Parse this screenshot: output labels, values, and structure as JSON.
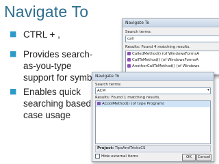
{
  "slide": {
    "title": "Navigate To",
    "bullets": [
      "CTRL + ,",
      "Provides search-as-you-type support for symbols",
      "Enables quick searching based on case usage"
    ]
  },
  "dialog_back": {
    "title": "Navigate To",
    "search_label": "Search terms:",
    "search_value": "call",
    "results_label": "Results: Found 4 matching results.",
    "results": [
      "CalledMethod() (of WindowsFormsA",
      "CallToMethod() (of WindowsFormsA",
      "AnotherCallToMethod() (of Windows"
    ]
  },
  "dialog_front": {
    "title": "Navigate To",
    "search_label": "Search terms:",
    "search_value": "ACM",
    "results_label": "Results: Found 1 matching results.",
    "results": [
      "ACoolMethod() (of type Program)"
    ],
    "project_label": "Project:",
    "project_value": "TipsAndTricksCS",
    "hide_external_label": "Hide external items",
    "ok_label": "OK",
    "cancel_label": "Cancel"
  }
}
